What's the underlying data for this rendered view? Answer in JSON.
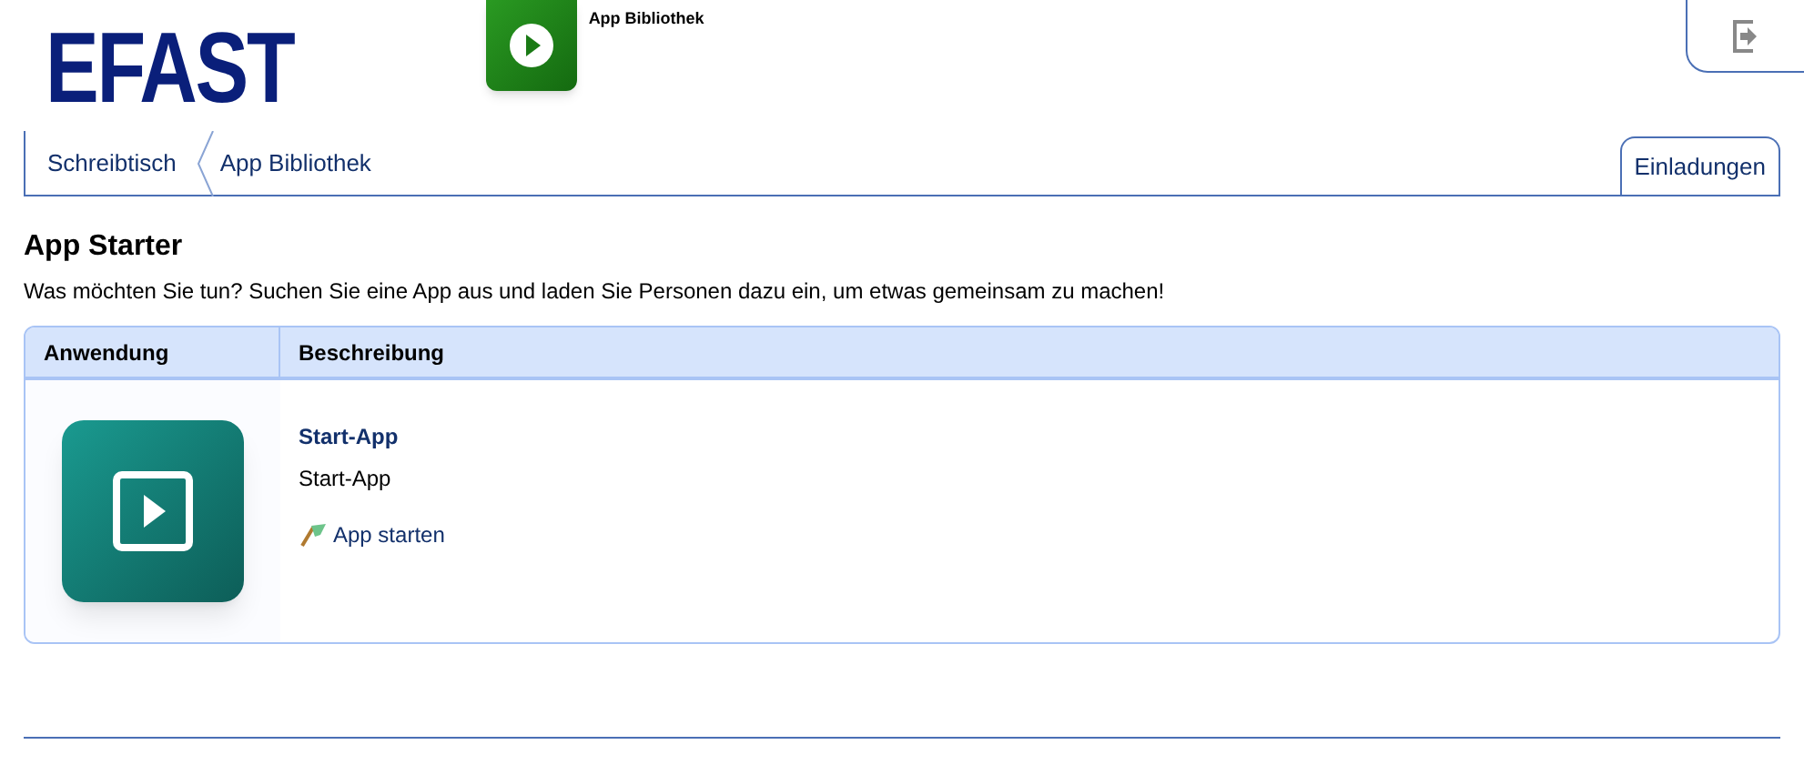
{
  "logo": "EFAST",
  "app_header": {
    "title": "App Bibliothek"
  },
  "breadcrumbs": [
    {
      "label": "Schreibtisch"
    },
    {
      "label": "App Bibliothek"
    }
  ],
  "invitations_tab": {
    "label": "Einladungen"
  },
  "heading": "App Starter",
  "intro": "Was möchten Sie tun? Suchen Sie eine App aus und laden Sie Personen dazu ein, um etwas gemeinsam zu machen!",
  "table": {
    "columns": [
      "Anwendung",
      "Beschreibung"
    ],
    "rows": [
      {
        "title": "Start-App",
        "description": "Start-App",
        "action": "App starten"
      }
    ]
  }
}
